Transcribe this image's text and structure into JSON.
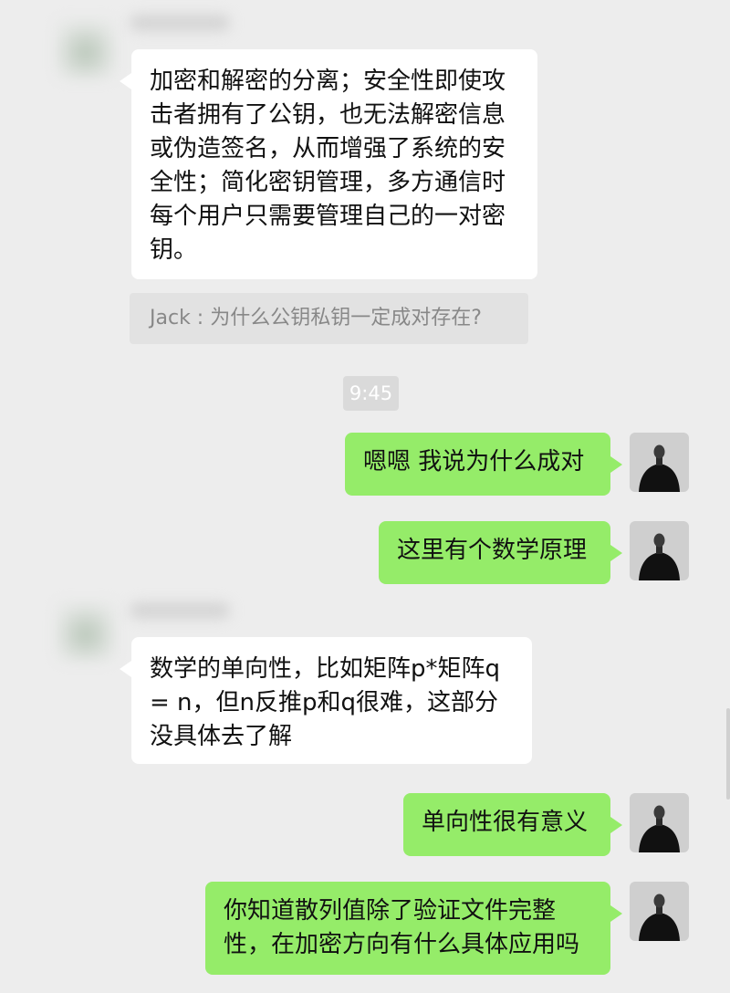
{
  "messages": {
    "m1": "加密和解密的分离；安全性即使攻击者拥有了公钥，也无法解密信息或伪造签名，从而增强了系统的安全性；简化密钥管理，多方通信时每个用户只需要管理自己的一对密钥。",
    "quote": "Jack : 为什么公钥私钥一定成对存在?",
    "time": "9:45",
    "m2": "嗯嗯 我说为什么成对",
    "m3": "这里有个数学原理",
    "m4": "数学的单向性，比如矩阵p*矩阵q = n，但n反推p和q很难，这部分没具体去了解",
    "m5": "单向性很有意义",
    "m6": "你知道散列值除了验证文件完整性，在加密方向有什么具体应用吗"
  },
  "colors": {
    "background": "#ededed",
    "incoming_bubble": "#ffffff",
    "outgoing_bubble": "#95ec69",
    "quote_bg": "#e2e2e2"
  },
  "icons": {
    "contact_avatar": "blurred-avatar",
    "my_avatar": "person-in-black-suit-photo"
  }
}
